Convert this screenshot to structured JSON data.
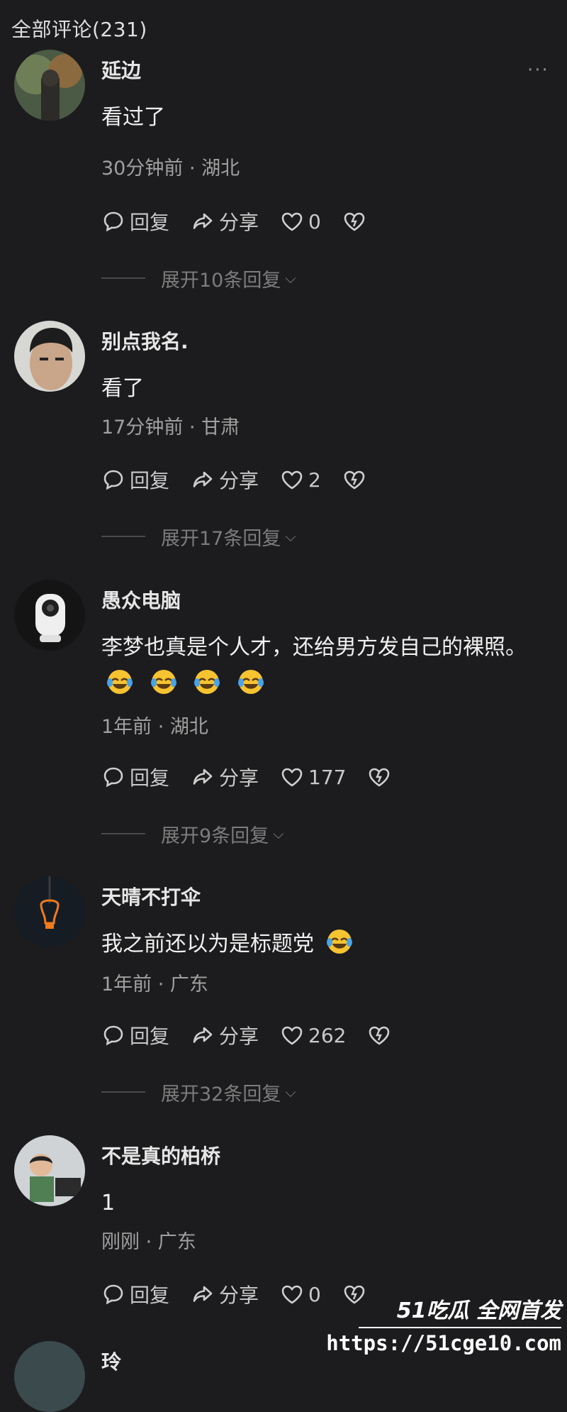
{
  "header": {
    "title": "全部评论(231)"
  },
  "actions": {
    "reply": "回复",
    "share": "分享"
  },
  "comments": [
    {
      "name": "延边",
      "text": "看过了",
      "meta": "30分钟前 · 湖北",
      "likes": "0",
      "expand": "展开10条回复"
    },
    {
      "name": "别点我名.",
      "text": "看了",
      "meta": "17分钟前 · 甘肃",
      "likes": "2",
      "expand": "展开17条回复"
    },
    {
      "name": "愚众电脑",
      "text": "李梦也真是个人才，还给男方发自己的裸照。",
      "meta": "1年前 · 湖北",
      "likes": "177",
      "expand": "展开9条回复",
      "emoji_count": 4
    },
    {
      "name": "天晴不打伞",
      "text": "我之前还以为是标题党",
      "meta": "1年前 · 广东",
      "likes": "262",
      "expand": "展开32条回复",
      "emoji_count": 1
    },
    {
      "name": "不是真的柏桥",
      "text": "1",
      "meta": "刚刚 · 广东",
      "likes": "0"
    },
    {
      "name": "玲"
    }
  ],
  "more_icon": "···",
  "watermark": {
    "brand": "51吃瓜 全网首发",
    "url": "https://51cge10.com"
  },
  "icons": {
    "reply": "comment-bubble-icon",
    "share": "share-arrow-icon",
    "like": "heart-icon",
    "dislike": "broken-heart-icon",
    "more": "more-dots-icon",
    "expand": "chevron-down-icon",
    "emoji": "laughing-tears-emoji"
  }
}
